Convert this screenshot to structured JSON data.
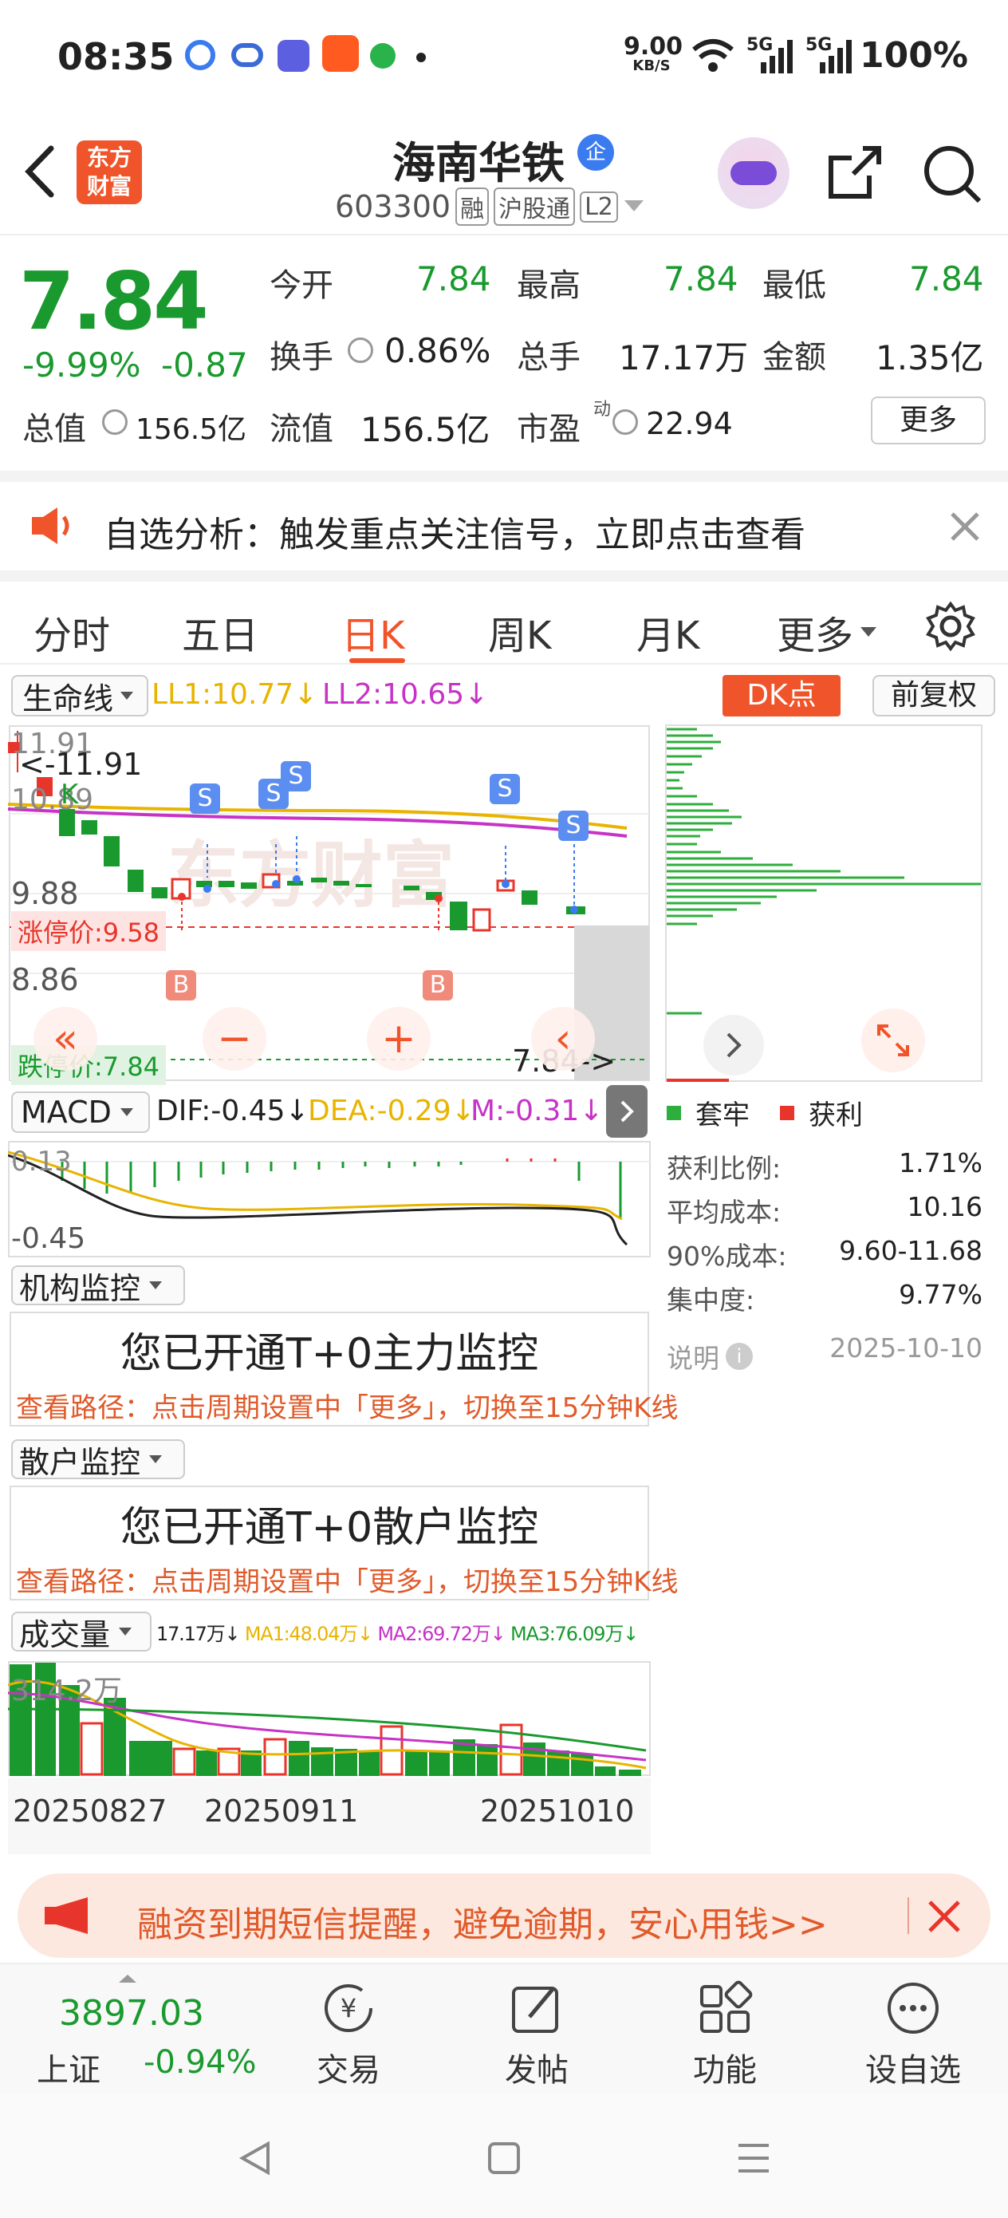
{
  "status": {
    "time": "08:35",
    "speed": "9.00",
    "speed_unit": "KB/S",
    "net1": "5G",
    "net2": "5G",
    "battery": "100%"
  },
  "header": {
    "logo_line1": "东方",
    "logo_line2": "财富",
    "stock_name": "海南华铁",
    "badge": "企",
    "code": "603300",
    "tag1": "融",
    "tag2": "沪股通",
    "tag3": "L2"
  },
  "quote": {
    "price": "7.84",
    "change_pct": "-9.99%",
    "change": "-0.87",
    "open_label": "今开",
    "open": "7.84",
    "high_label": "最高",
    "high": "7.84",
    "low_label": "最低",
    "low": "7.84",
    "turnover_label": "换手",
    "turnover": "0.86%",
    "volume_label": "总手",
    "volume": "17.17万",
    "amount_label": "金额",
    "amount": "1.35亿",
    "mcap_label": "总值",
    "mcap": "156.5亿",
    "float_label": "流值",
    "float": "156.5亿",
    "pe_label": "市盈",
    "pe_sup": "动",
    "pe": "22.94",
    "more": "更多"
  },
  "notice": {
    "text": "自选分析：触发重点关注信号，立即点击查看"
  },
  "tabs": [
    "分时",
    "五日",
    "日K",
    "周K",
    "月K",
    "更多"
  ],
  "kline": {
    "indicator": "生命线",
    "ll1": "LL1:10.77",
    "ll2": "LL2:10.65",
    "dk": "DK点",
    "adjust": "前复权",
    "p_top": "11.91",
    "p_top_mark": "<-11.91",
    "p_2": "10.89",
    "p_3": "9.88",
    "p_4": "8.86",
    "p_bot": "7.84",
    "limit_up": "涨停价:9.58",
    "limit_down": "跌停价:7.84",
    "last_mark": "7.84->",
    "s": "S",
    "b": "B",
    "arrow_up": "↓",
    "arrow_down": "↓"
  },
  "chips": {
    "legend1": "套牢",
    "legend2": "获利",
    "rows": [
      {
        "k": "获利比例:",
        "v": "1.71%"
      },
      {
        "k": "平均成本:",
        "v": "10.16"
      },
      {
        "k": "90%成本:",
        "v": "9.60-11.68"
      },
      {
        "k": "集中度:",
        "v": "9.77%"
      }
    ],
    "note": "说明",
    "date": "2025-10-10"
  },
  "macd": {
    "name": "MACD",
    "dif": "DIF:-0.45",
    "dea": "DEA:-0.29",
    "m": "M:-0.31",
    "top": "0.13",
    "bot": "-0.45"
  },
  "monitor1": {
    "name": "机构监控",
    "title": "您已开通T+0主力监控",
    "path": "查看路径：点击周期设置中「更多」，切换至15分钟K线"
  },
  "monitor2": {
    "name": "散户监控",
    "title": "您已开通T+0散户监控",
    "path": "查看路径：点击周期设置中「更多」，切换至15分钟K线"
  },
  "volume": {
    "name": "成交量",
    "v": "17.17万",
    "ma1": "MA1:48.04万",
    "ma2": "MA2:69.72万",
    "ma3": "MA3:76.09万",
    "top": "314.2万",
    "dates": [
      "20250827",
      "20250911",
      "20251010"
    ]
  },
  "banner": {
    "text": "融资到期短信提醒，避免逾期，安心用钱>>"
  },
  "bottom": {
    "index_value": "3897.03",
    "index_name": "上证",
    "index_change": "-0.94%",
    "trade": "交易",
    "post": "发帖",
    "func": "功能",
    "watch": "设自选"
  },
  "colors": {
    "green": "#1a9a2e",
    "red": "#e8352b",
    "orange": "#f0542a",
    "yellow": "#e8b400",
    "purple": "#c633c6"
  }
}
